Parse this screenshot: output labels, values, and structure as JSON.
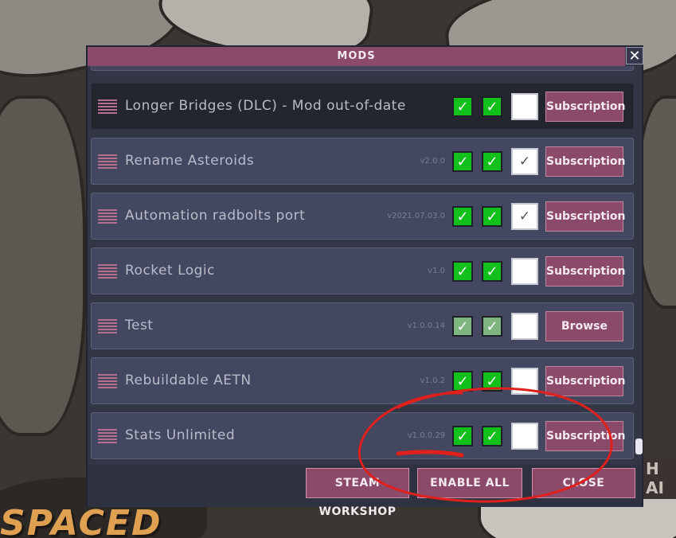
{
  "dialog": {
    "title": "MODS",
    "close_label": "✕"
  },
  "mods": [
    {
      "name": "",
      "version": "",
      "enabled": true,
      "active": true,
      "extra": false,
      "action": "",
      "partial": true
    },
    {
      "name": "Longer Bridges (DLC) - Mod out-of-date",
      "version": "",
      "enabled": true,
      "active": true,
      "extra": false,
      "action": "Subscription",
      "dark": true
    },
    {
      "name": "Rename Asteroids",
      "version": "v2.0.0",
      "enabled": true,
      "active": true,
      "extra": true,
      "action": "Subscription"
    },
    {
      "name": "Automation radbolts port",
      "version": "v2021.07.03.0",
      "enabled": true,
      "active": true,
      "extra": true,
      "action": "Subscription"
    },
    {
      "name": "Rocket Logic",
      "version": "v1.0",
      "enabled": true,
      "active": true,
      "extra": false,
      "action": "Subscription"
    },
    {
      "name": "Test",
      "version": "v1.0.0.14",
      "enabled": true,
      "active": true,
      "extra": false,
      "action": "Browse",
      "pale": true
    },
    {
      "name": "Rebuildable AETN",
      "version": "v1.0.2",
      "enabled": true,
      "active": true,
      "extra": false,
      "action": "Subscription"
    },
    {
      "name": "Stats Unlimited",
      "version": "v1.0.0.29",
      "enabled": true,
      "active": true,
      "extra": false,
      "action": "Subscription"
    }
  ],
  "footer": {
    "steam_workshop": "STEAM WORKSHOP",
    "enable_all": "ENABLE ALL",
    "close": "CLOSE"
  },
  "background": {
    "logo_text": "SPACED",
    "right_text": "H AI"
  },
  "colors": {
    "accent": "#8c4a6a",
    "check_green": "#11c01a",
    "panel": "#323645",
    "row": "#434760",
    "annotation": "#e0201c"
  },
  "icons": {
    "grip": "drag-handle-icon",
    "check": "checkmark-icon",
    "close": "close-icon"
  }
}
